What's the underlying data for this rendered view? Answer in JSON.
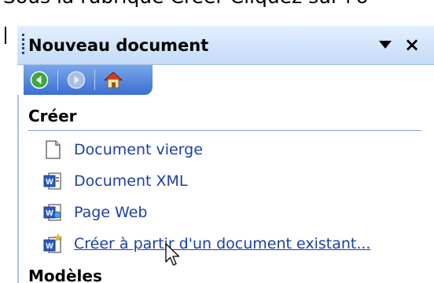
{
  "instruction_text": "Sous la rubrique Créer Cliquez sur l'o",
  "panel": {
    "title": "Nouveau document",
    "icons": {
      "grip": "grip-handle",
      "dropdown": "triangle-down",
      "close": "close-x"
    },
    "close_glyph": "×"
  },
  "nav": {
    "back": "back-arrow",
    "forward": "forward-arrow",
    "home": "home"
  },
  "sections": {
    "create": {
      "title": "Créer",
      "items": [
        {
          "label": "Document vierge",
          "icon": "blank-document"
        },
        {
          "label": "Document XML",
          "icon": "word-xml-document"
        },
        {
          "label": "Page Web",
          "icon": "word-web-page"
        },
        {
          "label": "Créer à partir d'un document existant...",
          "icon": "word-new-from-existing",
          "hovered": true
        }
      ]
    },
    "models": {
      "title": "Modèles"
    }
  },
  "colors": {
    "link": "#1b3fa8",
    "title_bar_top": "#e3effe",
    "title_bar_bottom": "#c4dbf7",
    "nav_bar": "#3a6fd3"
  }
}
